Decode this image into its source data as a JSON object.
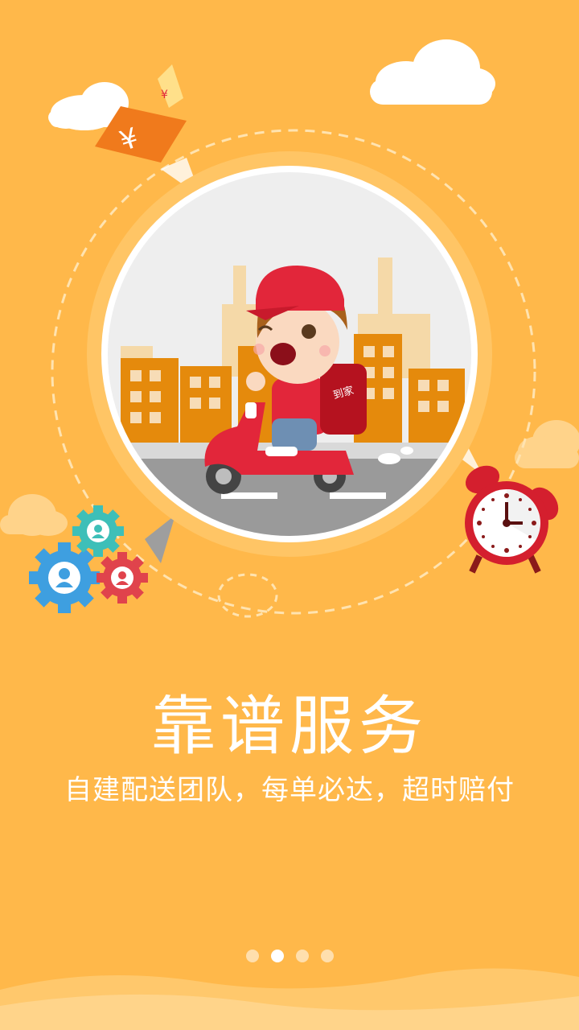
{
  "colors": {
    "background": "#FFB84A",
    "accent_red": "#E2263A",
    "building_orange": "#E58A0C",
    "text": "#FFFFFF"
  },
  "icons": [
    "cloud-icon",
    "money-bill-icon",
    "gear-icon",
    "alarm-clock-icon",
    "scooter-rider-icon"
  ],
  "courier": {
    "bag_label": "到家"
  },
  "onboarding": {
    "title": "靠谱服务",
    "subtitle": "自建配送团队，每单必达，超时赔付"
  },
  "pager": {
    "count": 4,
    "active_index": 1
  }
}
